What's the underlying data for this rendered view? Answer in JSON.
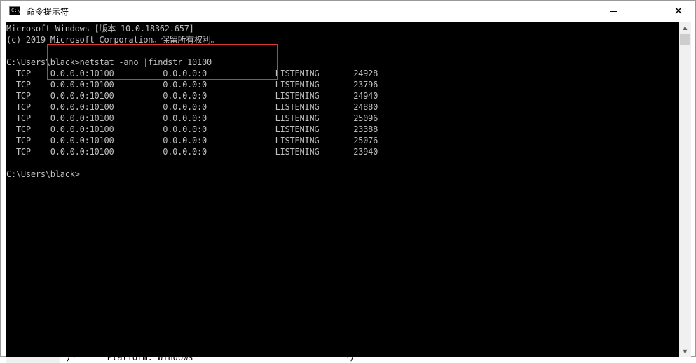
{
  "window": {
    "title": "命令提示符",
    "icon": "cmd-console-icon",
    "icon_text": "C:\\",
    "minimize_icon": "minimize-icon",
    "maximize_icon": "maximize-icon",
    "close_icon": "close-icon",
    "close_glyph": "✕"
  },
  "console": {
    "lines": [
      "Microsoft Windows [版本 10.0.18362.657]",
      "(c) 2019 Microsoft Corporation。保留所有权利。",
      "",
      "C:\\Users\\black>netstat -ano |findstr 10100",
      "  TCP    0.0.0.0:10100          0.0.0.0:0              LISTENING       24928",
      "  TCP    0.0.0.0:10100          0.0.0.0:0              LISTENING       23796",
      "  TCP    0.0.0.0:10100          0.0.0.0:0              LISTENING       24940",
      "  TCP    0.0.0.0:10100          0.0.0.0:0              LISTENING       24880",
      "  TCP    0.0.0.0:10100          0.0.0.0:0              LISTENING       25096",
      "  TCP    0.0.0.0:10100          0.0.0.0:0              LISTENING       23388",
      "  TCP    0.0.0.0:10100          0.0.0.0:0              LISTENING       25076",
      "  TCP    0.0.0.0:10100          0.0.0.0:0              LISTENING       23940",
      "",
      "C:\\Users\\black>"
    ],
    "text_color": "#c0c0c0",
    "background": "#000000",
    "highlight_color": "#e0342f"
  },
  "scrollbar": {
    "up_glyph": "▲",
    "down_glyph": "▼"
  },
  "background_window": {
    "left_chars": [
      "·",
      "·",
      "·",
      "·",
      "·",
      "·",
      "·",
      "·",
      "·",
      "·",
      "·",
      "·",
      "·",
      "·"
    ],
    "right_char": "",
    "bottom_text": "/*      Platform: Windows                              */"
  }
}
